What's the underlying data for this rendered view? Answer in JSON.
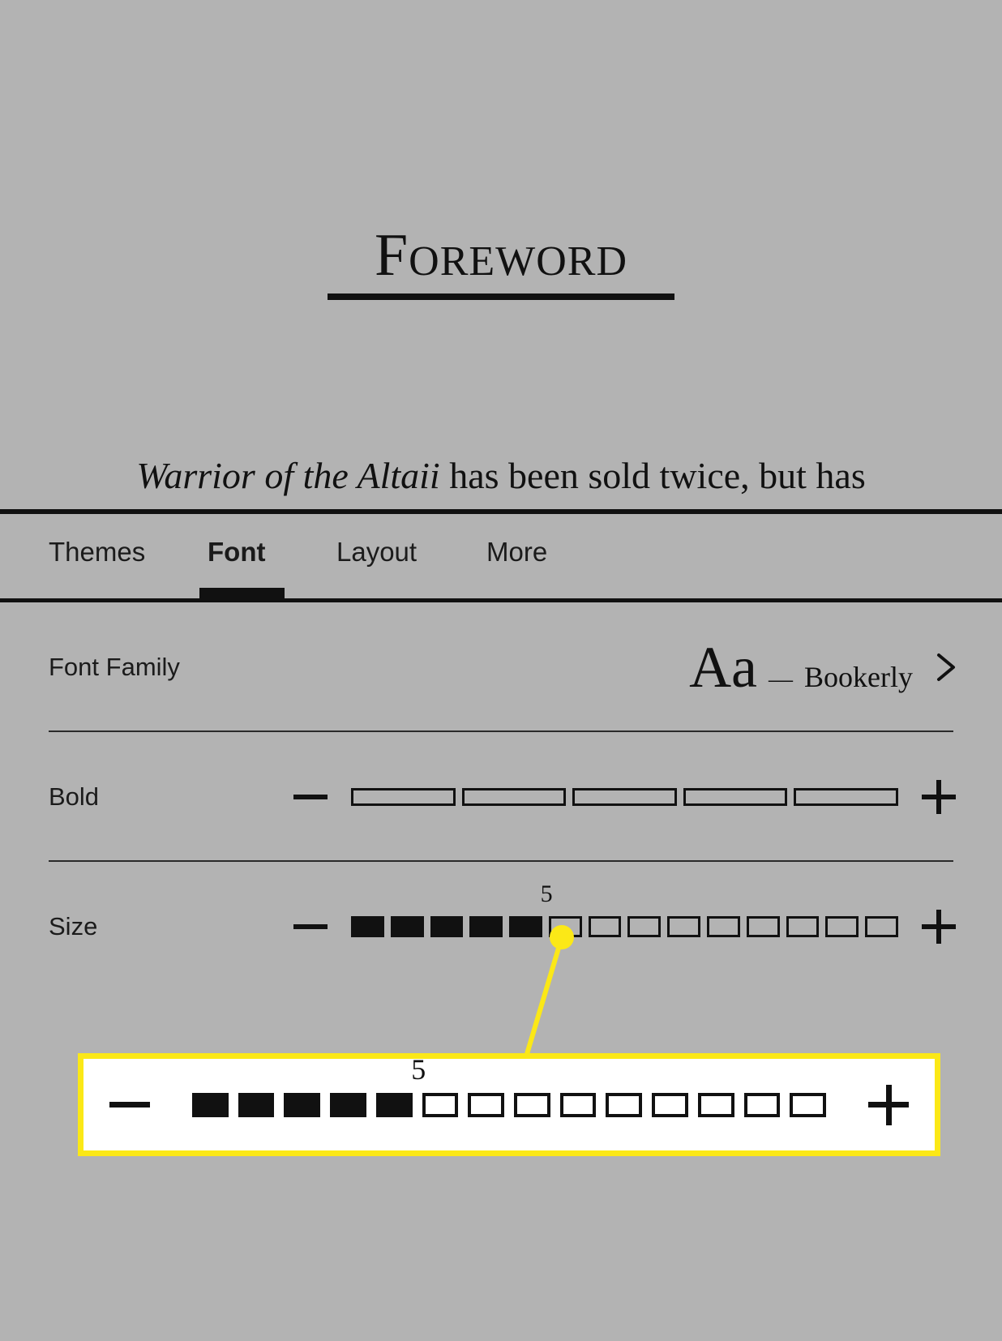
{
  "colors": {
    "background": "#b3b3b3",
    "ink": "#111111",
    "highlight": "#fbe817",
    "callout_fill": "#ffffff"
  },
  "book": {
    "chapter_title": "Foreword",
    "body_line_italic": "Warrior of the Altaii",
    "body_line_rest": " has been sold twice, but has"
  },
  "settings": {
    "tabs": [
      {
        "label": "Themes",
        "active": false
      },
      {
        "label": "Font",
        "active": true
      },
      {
        "label": "Layout",
        "active": false
      },
      {
        "label": "More",
        "active": false
      }
    ],
    "rows": {
      "font_family": {
        "label": "Font Family",
        "sample_glyphs": "Aa",
        "dash": "—",
        "value": "Bookerly",
        "chevron_icon": "chevron-right-icon"
      },
      "bold": {
        "label": "Bold",
        "minus_icon": "minus-icon",
        "plus_icon": "plus-icon",
        "segments_total": 5,
        "segments_filled": 0,
        "value": 0
      },
      "size": {
        "label": "Size",
        "minus_icon": "minus-icon",
        "plus_icon": "plus-icon",
        "segments_total": 14,
        "segments_filled": 5,
        "value": "5",
        "value_label": "5"
      }
    }
  },
  "callout": {
    "marker_icon": "highlight-dot-icon",
    "magnified_control": "size-stepper",
    "value_label": "5",
    "segments_total": 14,
    "segments_filled": 5,
    "minus_icon": "minus-icon",
    "plus_icon": "plus-icon"
  }
}
